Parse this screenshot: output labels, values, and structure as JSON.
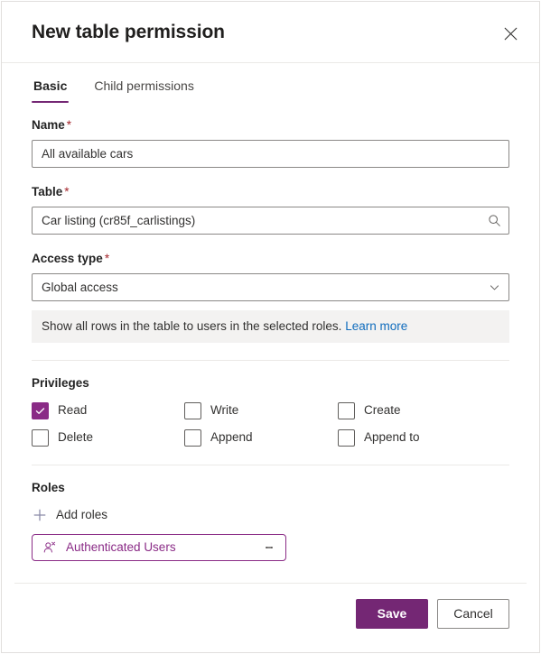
{
  "dialog": {
    "title": "New table permission",
    "close_label": "Close"
  },
  "tabs": [
    {
      "label": "Basic",
      "active": true
    },
    {
      "label": "Child permissions",
      "active": false
    }
  ],
  "form": {
    "name": {
      "label": "Name",
      "required": "*",
      "value": "All available cars",
      "placeholder": ""
    },
    "table": {
      "label": "Table",
      "required": "*",
      "value": "Car listing (cr85f_carlistings)",
      "placeholder": "",
      "icon": "search-icon"
    },
    "access_type": {
      "label": "Access type",
      "required": "*",
      "value": "Global access",
      "icon": "chevron-down-icon",
      "helper_text": "Show all rows in the table to users in the selected roles.",
      "helper_link": "Learn more"
    }
  },
  "privileges": {
    "title": "Privileges",
    "items": [
      {
        "label": "Read",
        "checked": true
      },
      {
        "label": "Write",
        "checked": false
      },
      {
        "label": "Create",
        "checked": false
      },
      {
        "label": "Delete",
        "checked": false
      },
      {
        "label": "Append",
        "checked": false
      },
      {
        "label": "Append to",
        "checked": false
      }
    ]
  },
  "roles": {
    "title": "Roles",
    "add_label": "Add roles",
    "add_icon": "plus-icon",
    "chips": [
      {
        "label": "Authenticated Users",
        "icon": "person-icon",
        "menu_icon": "more-vertical-icon"
      }
    ]
  },
  "footer": {
    "save_label": "Save",
    "cancel_label": "Cancel"
  },
  "colors": {
    "accent": "#742774",
    "checkbox_checked": "#8a2b86",
    "link": "#0f6cbd",
    "required": "#a4262c",
    "helper_bg": "#f3f2f1"
  }
}
